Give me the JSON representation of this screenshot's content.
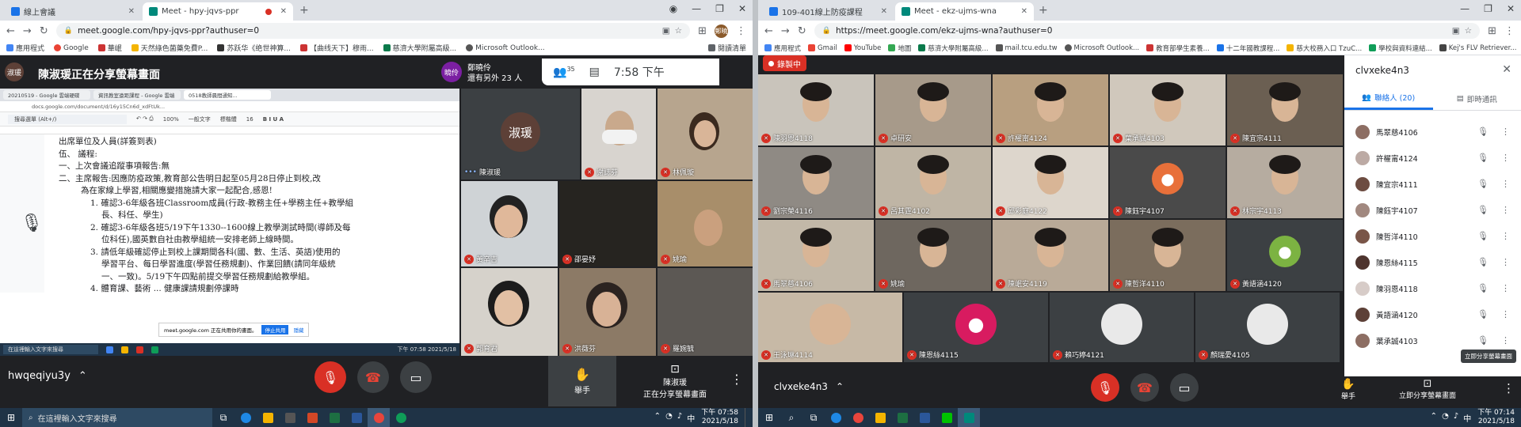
{
  "left": {
    "tabs": [
      {
        "title": "線上會議"
      },
      {
        "title": "Meet - hpy-jqvs-ppr"
      }
    ],
    "url": "meet.google.com/hpy-jqvs-ppr?authuser=0",
    "profile_initials": "鄭曉",
    "bookmarks": [
      "應用程式",
      "Google",
      "華岷",
      "天然綠色菌藥免費P...",
      "苏跃华《绝世神算...",
      "【曲线天下】穆雨...",
      "慈濟大學附屬高級...",
      "Microsoft Outlook..."
    ],
    "reading_list": "閱讀清單",
    "presenter_banner": "陳淑瑗正在分享螢幕畫面",
    "presenter_avatar": "淑瑗",
    "caller": {
      "avatar": "曉伶",
      "name": "鄭曉伶",
      "sub": "還有另外 23 人"
    },
    "people_count": "35",
    "time": "7:58 下午",
    "shared_doc": {
      "tabs": [
        "20210519 - Google 雲端硬碟",
        "資訊教室遠距課程 - Google 雲端",
        "0518教師晨間通知..."
      ],
      "url": "docs.google.com/document/d/16y15Cn6d_xdFtUk...",
      "menu": "搜尋選單 (Alt+/)",
      "zoom": "100%",
      "style": "一般文字",
      "font": "標楷體",
      "size": "16",
      "lines": [
        "出席單位及人員(詳簽到表)",
        "伍、 議程:",
        "一、上次會議追蹤事項報告:無",
        "二、主席報告:因應防疫政策,教育部公告明日起至05月28日停止到校,改",
        "為在家線上學習,相關應變措施請大家一起配合,感恩!",
        "1. 確認3-6年級各班Classroom成員(行政-教務主任+學務主任+教學組",
        "長、科任、學生)",
        "2. 確認3-6年級各班5/19下午1330--1600線上教學測試時間(導師及每",
        "位科任),國英數自社由教學組統一安排老師上線時間。",
        "3. 請低年級確認停止到校上課期間各科(國、數、生活、英語)使用的",
        "學習平台、每日學習進度(學習任務規劃)、作業回饋(請同年級統",
        "一、一致)。5/19下午四點前提交學習任務規劃給教學組。",
        "4. 體育課、藝術 ... 健康課請規劃停課時"
      ],
      "share_note": "meet.google.com 正在共用你的畫面。",
      "stop_share": "停止共用",
      "hide": "隱藏",
      "search": "在這裡輸入文字來搜尋",
      "clock": "下午 07:58 2021/5/18"
    },
    "tiles": [
      {
        "name": "陳淑瑗"
      },
      {
        "name": "謝誌芬"
      },
      {
        "name": "林佩璇"
      },
      {
        "name": "黃辛吉"
      },
      {
        "name": "邵晏妤"
      },
      {
        "name": "姚瑜"
      },
      {
        "name": "郭育君"
      },
      {
        "name": "洪薇芬"
      },
      {
        "name": "羅婉毓"
      }
    ],
    "meeting_code": "hwqeqiyu3y",
    "raise_hand": "舉手",
    "presenting": {
      "line1": "陳淑瑗",
      "line2": "正在分享螢幕畫面"
    },
    "search": "在這裡輸入文字來搜尋",
    "clock_time": "下午 07:58",
    "clock_date": "2021/5/18"
  },
  "right": {
    "tabs": [
      {
        "title": "109-401線上防疫課程"
      },
      {
        "title": "Meet - ekz-ujms-wna"
      }
    ],
    "url": "https://meet.google.com/ekz-ujms-wna?authuser=0",
    "bookmarks": [
      "應用程式",
      "Gmail",
      "YouTube",
      "地圖",
      "慈濟大學附屬高級...",
      "mail.tcu.edu.tw",
      "Microsoft Outlook...",
      "教育部學生素養...",
      "十二年國教課程...",
      "慈大校務入口 TzuC...",
      "學校與資料連結...",
      "Kej's FLV Retriever..."
    ],
    "recording": "錄製中",
    "tiles": [
      {
        "name": "陳羽恩4118"
      },
      {
        "name": "卓研安"
      },
      {
        "name": "許櫂甯4124"
      },
      {
        "name": "葉承誠4103"
      },
      {
        "name": "陳宜宗4111"
      },
      {
        "name": "劉宗榮4116"
      },
      {
        "name": "呂其霆4102"
      },
      {
        "name": "邱彩庭4122"
      },
      {
        "name": "陳鈺宇4107"
      },
      {
        "name": "林宗宇4113"
      },
      {
        "name": "馬翠慈4106"
      },
      {
        "name": "姚瑜"
      },
      {
        "name": "陳岷安4119"
      },
      {
        "name": "陳哲洋4110"
      },
      {
        "name": "黃語涵4120"
      },
      {
        "name": "王泳琳4114"
      },
      {
        "name": "陳恩絲4115"
      },
      {
        "name": "賴巧婷4121"
      },
      {
        "name": "顏瑞愛4105"
      }
    ],
    "meeting_code": "clvxeke4n3",
    "panel": {
      "title": "clvxeke4n3",
      "tab_people": "聯絡人 (20)",
      "tab_chat": "即時通訊",
      "people": [
        {
          "name": "馬翠慈4106"
        },
        {
          "name": "許櫂甯4124"
        },
        {
          "name": "陳宜宗4111"
        },
        {
          "name": "陳鈺宇4107"
        },
        {
          "name": "陳哲洋4110"
        },
        {
          "name": "陳恩絲4115"
        },
        {
          "name": "陳羽恩4118"
        },
        {
          "name": "黃語涵4120"
        },
        {
          "name": "葉承誠4103"
        }
      ],
      "tooltip": "立即分享螢幕畫面"
    },
    "raise_hand": "舉手",
    "present": "立即分享螢幕畫面",
    "clock_time": "下午 07:14",
    "clock_date": "2021/5/18"
  }
}
